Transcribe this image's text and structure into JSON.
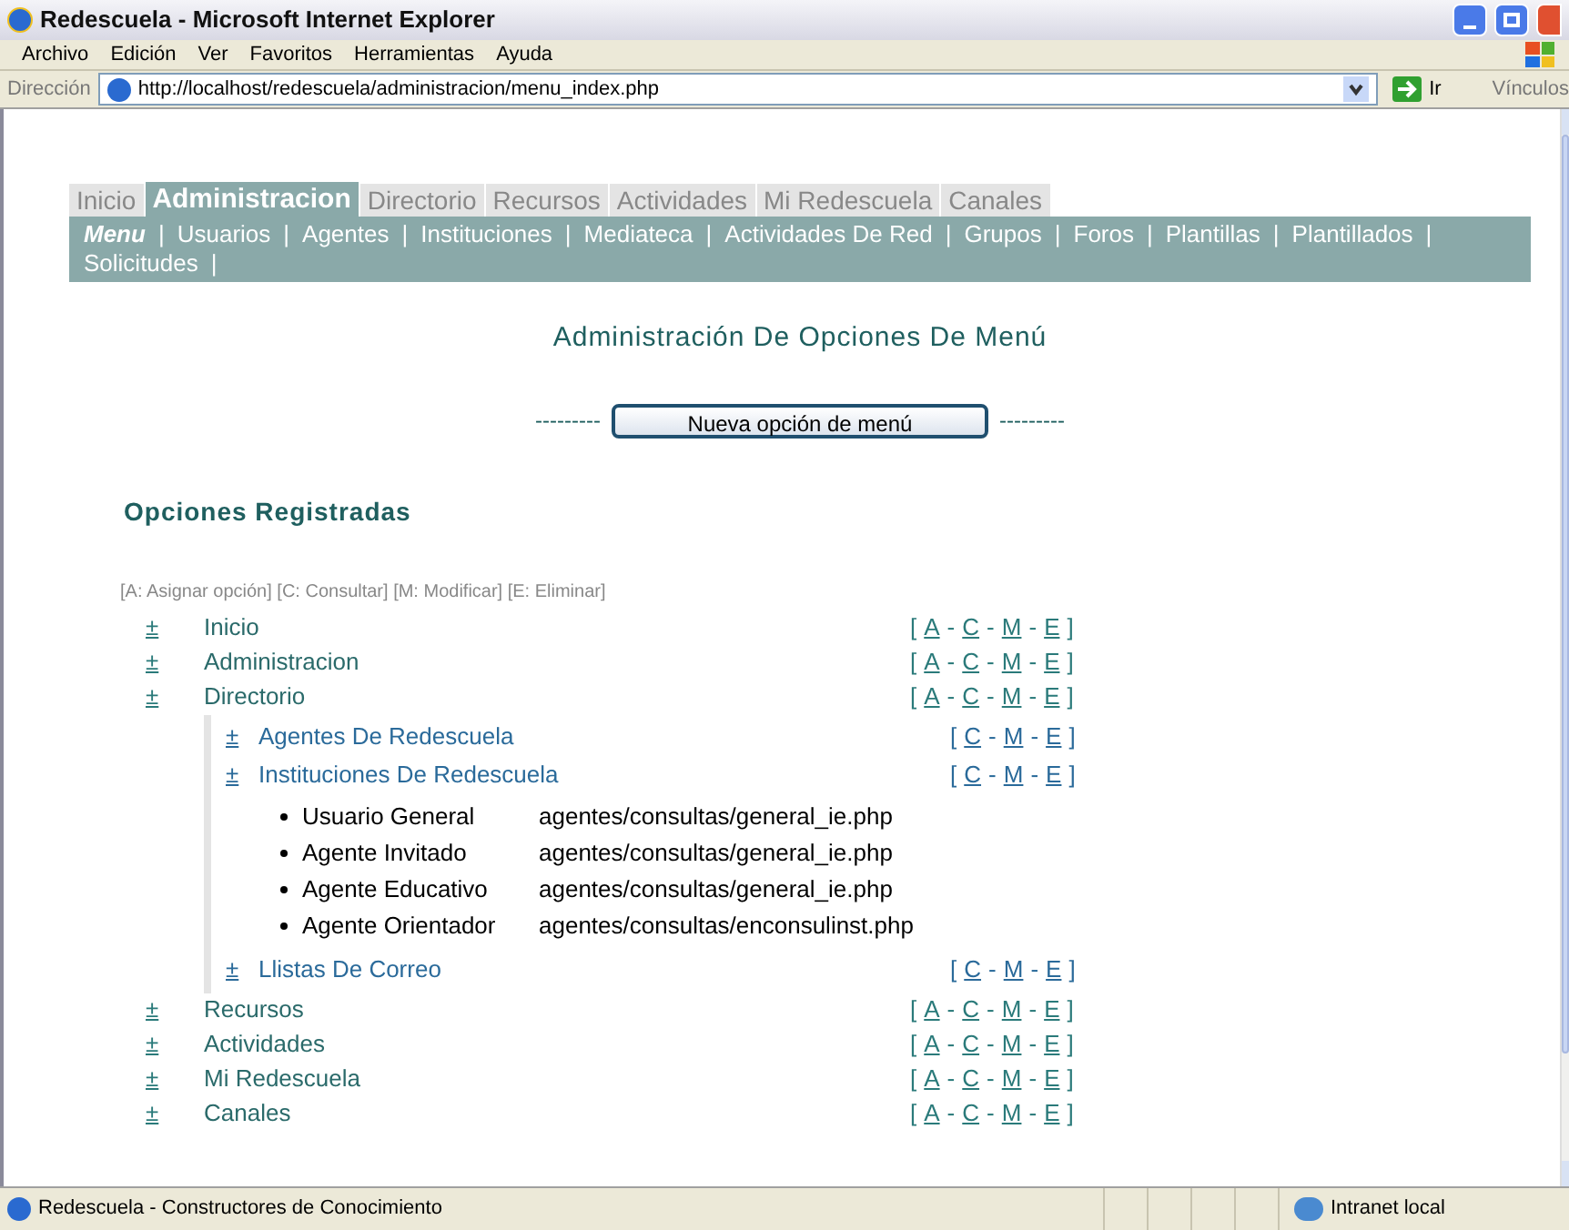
{
  "window": {
    "title": "Redescuela - Microsoft Internet Explorer"
  },
  "menu_bar": [
    "Archivo",
    "Edición",
    "Ver",
    "Favoritos",
    "Herramientas",
    "Ayuda"
  ],
  "address_bar": {
    "label": "Dirección",
    "url": "http://localhost/redescuela/administracion/menu_index.php",
    "go": "Ir",
    "links": "Vínculos"
  },
  "tabs": [
    {
      "label": "Inicio",
      "selected": false
    },
    {
      "label": "Administracion",
      "selected": true
    },
    {
      "label": "Directorio",
      "selected": false
    },
    {
      "label": "Recursos",
      "selected": false
    },
    {
      "label": "Actividades",
      "selected": false
    },
    {
      "label": "Mi Redescuela",
      "selected": false
    },
    {
      "label": "Canales",
      "selected": false
    }
  ],
  "submenu": [
    {
      "label": "Menu",
      "selected": true
    },
    {
      "label": "Usuarios",
      "selected": false
    },
    {
      "label": "Agentes",
      "selected": false
    },
    {
      "label": "Instituciones",
      "selected": false
    },
    {
      "label": "Mediateca",
      "selected": false
    },
    {
      "label": "Actividades De Red",
      "selected": false
    },
    {
      "label": "Grupos",
      "selected": false
    },
    {
      "label": "Foros",
      "selected": false
    },
    {
      "label": "Plantillas",
      "selected": false
    },
    {
      "label": "Plantillados",
      "selected": false
    },
    {
      "label": "Solicitudes",
      "selected": false
    }
  ],
  "submenu_separator": "|",
  "heading": "Administración De Opciones De Menú",
  "new_button": {
    "label": "Nueva opción de menú",
    "dashes_left": "---------",
    "dashes_right": "---------"
  },
  "section_title": "Opciones Registradas",
  "legend": "[A: Asignar opción] [C: Consultar] [M: Modificar] [E: Eliminar]",
  "action_format": {
    "open": "[",
    "sep": "-",
    "close": "]"
  },
  "tree": [
    {
      "toggle": "±",
      "label": "Inicio",
      "actions": [
        "A",
        "C",
        "M",
        "E"
      ]
    },
    {
      "toggle": "±",
      "label": "Administracion",
      "actions": [
        "A",
        "C",
        "M",
        "E"
      ]
    },
    {
      "toggle": "±",
      "label": "Directorio",
      "actions": [
        "A",
        "C",
        "M",
        "E"
      ],
      "children": [
        {
          "toggle": "±",
          "label": "Agentes De Redescuela",
          "actions": [
            "C",
            "M",
            "E"
          ]
        },
        {
          "toggle": "±",
          "label": "Instituciones De Redescuela",
          "actions": [
            "C",
            "M",
            "E"
          ],
          "children": [
            {
              "label": "Usuario General",
              "path": "agentes/consultas/general_ie.php"
            },
            {
              "label": "Agente Invitado",
              "path": "agentes/consultas/general_ie.php"
            },
            {
              "label": "Agente Educativo",
              "path": "agentes/consultas/general_ie.php"
            },
            {
              "label": "Agente Orientador",
              "path": "agentes/consultas/enconsulinst.php"
            }
          ]
        },
        {
          "toggle": "±",
          "label": "Llistas De Correo",
          "actions": [
            "C",
            "M",
            "E"
          ]
        }
      ]
    },
    {
      "toggle": "±",
      "label": "Recursos",
      "actions": [
        "A",
        "C",
        "M",
        "E"
      ]
    },
    {
      "toggle": "±",
      "label": "Actividades",
      "actions": [
        "A",
        "C",
        "M",
        "E"
      ]
    },
    {
      "toggle": "±",
      "label": "Mi Redescuela",
      "actions": [
        "A",
        "C",
        "M",
        "E"
      ]
    },
    {
      "toggle": "±",
      "label": "Canales",
      "actions": [
        "A",
        "C",
        "M",
        "E"
      ]
    }
  ],
  "status_bar": {
    "text": "Redescuela - Constructores de Conocimiento",
    "zone": "Intranet local"
  }
}
